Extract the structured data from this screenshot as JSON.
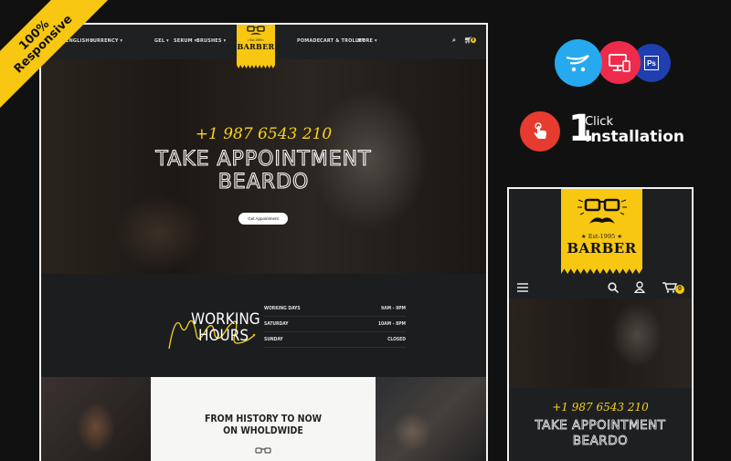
{
  "badge": {
    "line1": "100%",
    "line2": "Responsive"
  },
  "desktop": {
    "nav": {
      "language": "ENGLISH",
      "currency": "CURRENCY",
      "menu_left": [
        "GEL",
        "SERUM",
        "BRUSHES"
      ],
      "menu_right": [
        "POMADE",
        "CART & TROLLEY",
        "MORE"
      ],
      "cart_count": "0"
    },
    "logo": {
      "est": "• Est.1995 •",
      "brand": "BARBER"
    },
    "hero": {
      "phone": "+1 987 6543 210",
      "title_line1": "TAKE APPOINTMENT",
      "title_line2": "BEARDO",
      "button": "Get Appointment"
    },
    "hours": {
      "title_line1": "WORKING",
      "title_line2": "HOURS",
      "script_word": "Work",
      "rows": [
        {
          "day": "WORKING DAYS",
          "time": "9AM - 9PM"
        },
        {
          "day": "SATURDAY",
          "time": "10AM - 8PM"
        },
        {
          "day": "SUNDAY",
          "time": "CLOSED"
        }
      ]
    },
    "gallery": {
      "heading_line1": "FROM HISTORY TO NOW",
      "heading_line2": "ON WHOLDWIDE"
    }
  },
  "features": {
    "icons": [
      "opencart-icon",
      "responsive-devices-icon",
      "photoshop-icon"
    ],
    "ps_label": "Ps",
    "install_number": "1",
    "install_small": "Click",
    "install_big": "Installation",
    "colors": {
      "opencart": "#27a9ef",
      "responsive": "#ee2b4b",
      "photoshop": "#1f3fb0",
      "click": "#e63c2f",
      "accent": "#f7c712"
    }
  },
  "mobile": {
    "logo": {
      "est": "★ Est-1995 ★",
      "brand": "BARBER"
    },
    "cart_count": "0",
    "hero": {
      "phone": "+1 987 6543 210",
      "title_line1": "TAKE APPOINTMENT",
      "title_line2": "BEARDO"
    }
  }
}
